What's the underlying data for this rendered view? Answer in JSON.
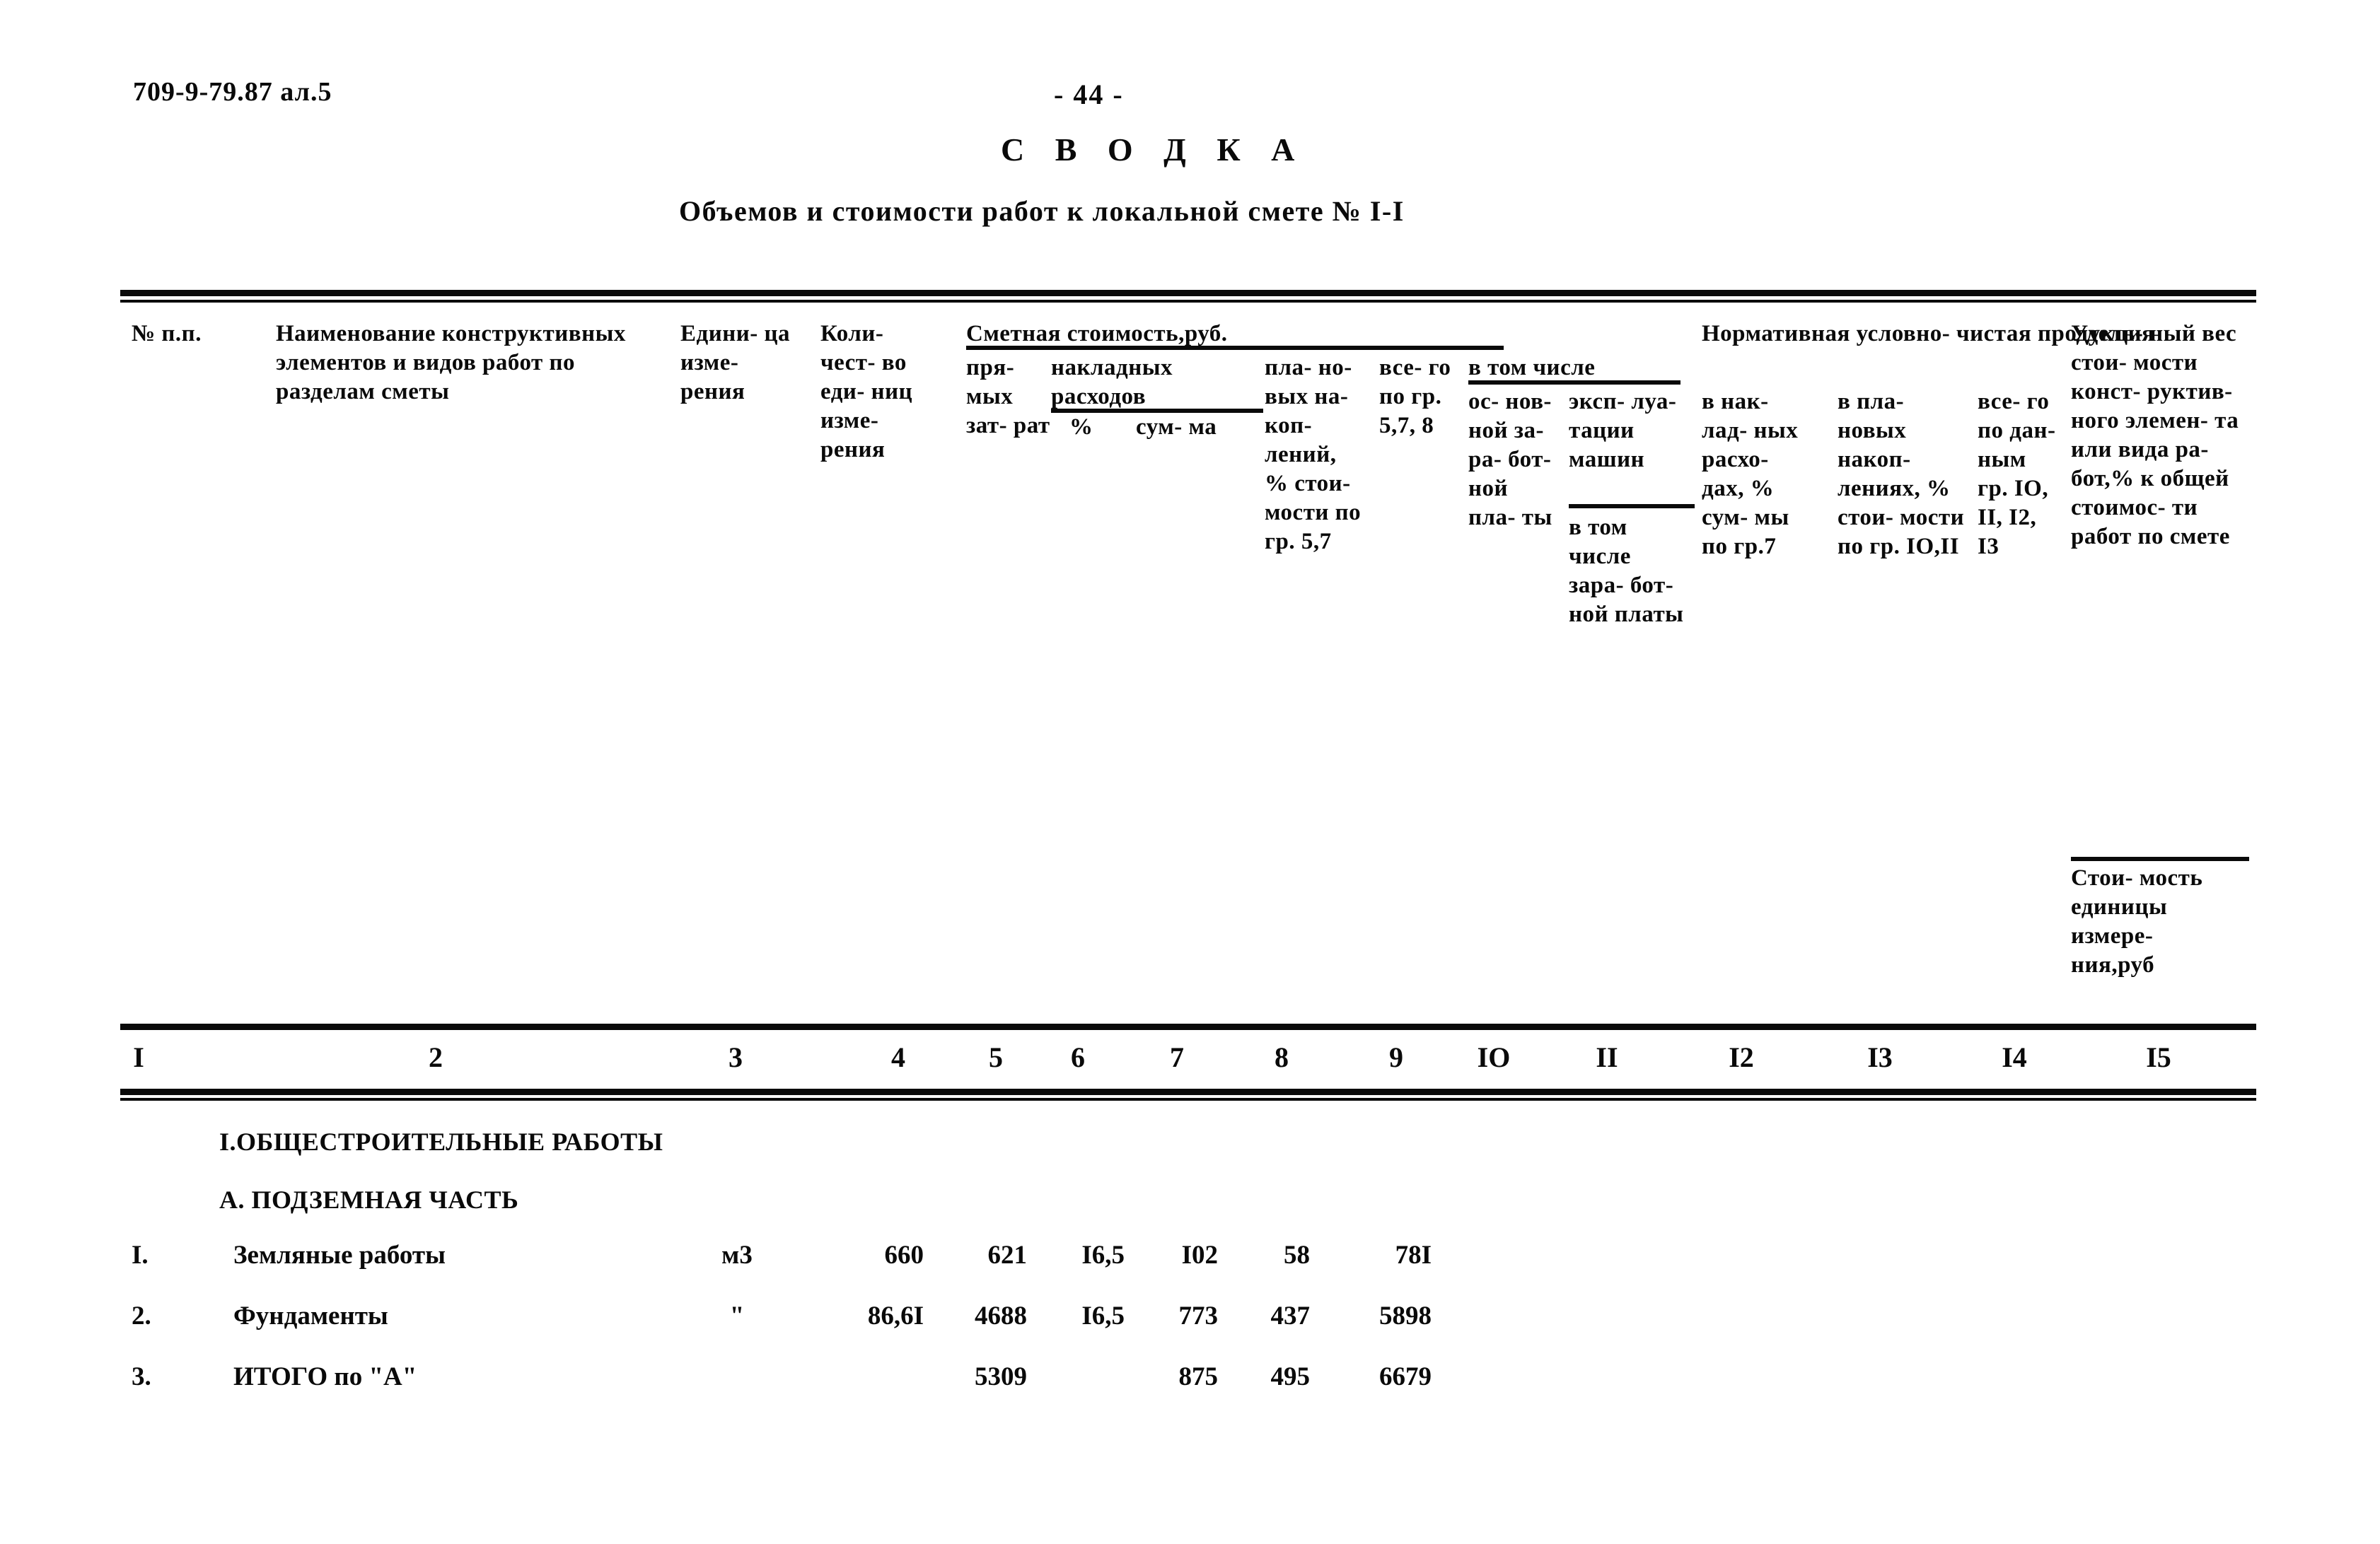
{
  "document": {
    "code": "709-9-79.87 ал.5",
    "page_number": "- 44 -",
    "title": "С В О Д К А",
    "subtitle": "Объемов и стоимости работ к локальной смете № I-I"
  },
  "table": {
    "header": {
      "col1": "№\nп.п.",
      "col2": "Наименование\nконструктивных\nэлементов и\nвидов работ по\nразделам сметы",
      "col3": "Едини-\nца\nизме-\nрения",
      "col4": "Коли-\nчест-\nво\nеди-\nниц\nизме-\nрения",
      "group_smetnaya": "Сметная стоимость,руб.",
      "col5": "пря-\nмых\nзат-\nрат",
      "group_nakladnyh": "накладных\nрасходов",
      "col6": "%",
      "col7": "сум-\nма",
      "col8": "пла-\nно-\nвых\nна-\nкоп-\nлений,\n%\nстои-\nмости\nпо гр.\n5,7",
      "col9": "все-\nго\nпо\nгр.\n5,7,\n8",
      "group_vtomchisle": "в том числе",
      "col10": "ос-\nнов-\nной\nза-\nра-\nбот-\nной\nпла-\nты",
      "col11a": "эксп-\nлуа-\nтации\nмашин",
      "col11b": "в том\nчисле\nзара-\nбот-\nной\nплаты",
      "group_normativnaya": "Нормативная условно-\nчистая продукция",
      "col12": "в нак-\nлад-\nных\nрасхо-\nдах,\n% сум-\nмы по\nгр.7",
      "col13": "в пла-\nновых\nнакоп-\nлениях,\n% стои-\nмости\nпо гр.\nIO,II",
      "col14": "все-\nго\nпо\nдан-\nным\nгр.\nIO,\nII,\nI2,\nI3",
      "col15a": "Удель-\nный\nвес\nстои-\nмости\nконст-\nруктив-\nного\nэлемен-\nта или\nвида ра-\nбот,% к\nобщей\nстоимос-\nти работ\nпо смете",
      "col15b": "Стои-\nмость\nединицы\nизмере-\nния,руб"
    },
    "column_numbers": [
      "I",
      "2",
      "3",
      "4",
      "5",
      "6",
      "7",
      "8",
      "9",
      "IO",
      "II",
      "I2",
      "I3",
      "I4",
      "I5"
    ],
    "sections": [
      {
        "label": "I.ОБЩЕСТРОИТЕЛЬНЫЕ РАБОТЫ"
      },
      {
        "label": "А. ПОДЗЕМНАЯ ЧАСТЬ"
      }
    ],
    "rows": [
      {
        "idx": "I.",
        "name": "Земляные работы",
        "unit": "м3",
        "col4": "660",
        "col5": "621",
        "col6": "I6,5",
        "col7": "I02",
        "col8": "58",
        "col9": "78I"
      },
      {
        "idx": "2.",
        "name": "Фундаменты",
        "unit": "\"",
        "col4": "86,6I",
        "col5": "4688",
        "col6": "I6,5",
        "col7": "773",
        "col8": "437",
        "col9": "5898"
      },
      {
        "idx": "3.",
        "name": "ИТОГО по \"А\"",
        "unit": "",
        "col4": "",
        "col5": "5309",
        "col6": "",
        "col7": "875",
        "col8": "495",
        "col9": "6679"
      }
    ]
  }
}
